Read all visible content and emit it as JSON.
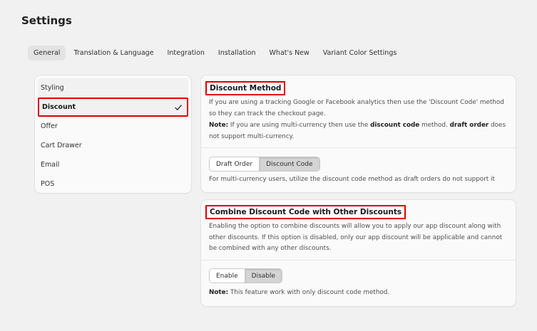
{
  "page": {
    "title": "Settings"
  },
  "tabs": [
    {
      "label": "General",
      "active": true
    },
    {
      "label": "Translation & Language"
    },
    {
      "label": "Integration"
    },
    {
      "label": "Installation"
    },
    {
      "label": "What's New"
    },
    {
      "label": "Variant Color Settings"
    }
  ],
  "sidebar": {
    "items": [
      {
        "label": "Styling"
      },
      {
        "label": "Discount",
        "selected": true,
        "icon": "checkmark-icon"
      },
      {
        "label": "Offer"
      },
      {
        "label": "Cart Drawer"
      },
      {
        "label": "Email"
      },
      {
        "label": "POS"
      }
    ]
  },
  "discount_method": {
    "title": "Discount Method",
    "description": "If you are using a tracking Google or Facebook analytics then use the 'Discount Code' method so they can track the checkout page.",
    "note_label": "Note:",
    "note_text_1": " If you are using multi-currency then use the ",
    "note_bold_1": "discount code",
    "note_text_2": " method. ",
    "note_bold_2": "draft order",
    "note_text_3": " does not support multi-currency.",
    "options": [
      "Draft Order",
      "Discount Code"
    ],
    "selected_option": "Discount Code",
    "help_text": "For multi-currency users, utilize the discount code method as draft orders do not support it"
  },
  "combine_discount": {
    "title": "Combine Discount Code with Other Discounts",
    "description": "Enabling the option to combine discounts will allow you to apply our app discount along with other discounts. If this option is disabled, only our app discount will be applicable and cannot be combined with any other discounts.",
    "options": [
      "Enable",
      "Disable"
    ],
    "selected_option": "Disable",
    "note_label": "Note:",
    "note_text": " This feature work with only discount code method."
  },
  "colors": {
    "highlight_border": "#e00000",
    "background": "#f1f1f1",
    "card": "#fafafa",
    "selected_segment": "#d4d4d4"
  }
}
